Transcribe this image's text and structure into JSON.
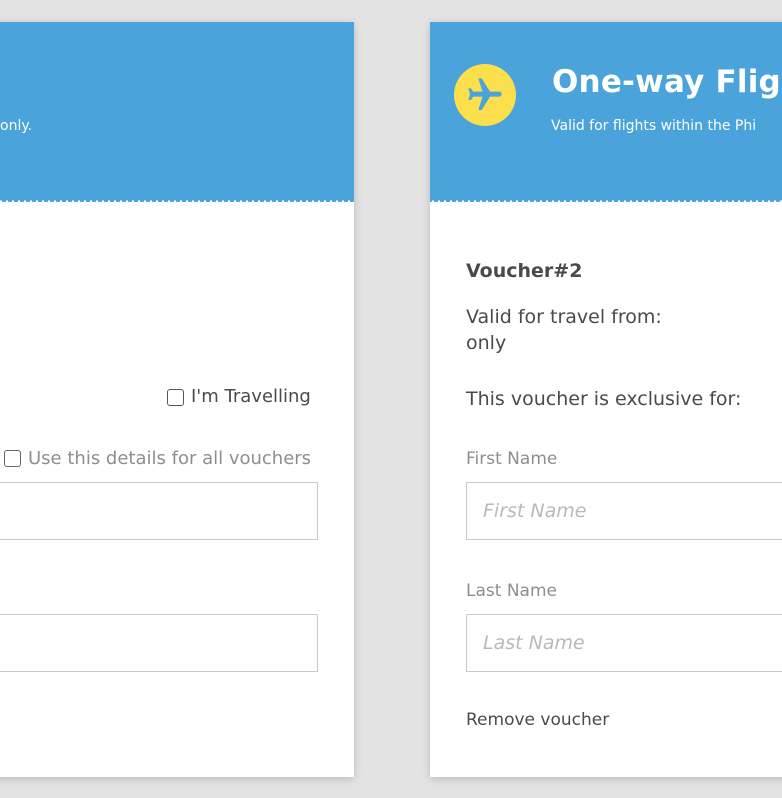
{
  "card1": {
    "subtitle_partial": "only.",
    "checkbox_travelling": "I'm Travelling",
    "checkbox_use_details": "Use this details for all vouchers"
  },
  "card2": {
    "title": "One-way Flig",
    "subtitle": "Valid for flights within the Phi",
    "voucher_title": "Voucher#2",
    "valid_from_line1": "Valid for travel from:",
    "valid_from_line2": "only",
    "exclusive_text": "This voucher is exclusive for:",
    "first_name_label": "First Name",
    "first_name_placeholder": "First Name",
    "last_name_label": "Last Name",
    "last_name_placeholder": "Last Name",
    "remove_link": "Remove voucher"
  },
  "icons": {
    "header": "airplane-icon"
  },
  "colors": {
    "header_blue": "#4aa3db",
    "badge_yellow": "#fbdf4d",
    "background": "#e3e3e3",
    "text": "#4a4a4a",
    "label_gray": "#8e8e8e"
  }
}
